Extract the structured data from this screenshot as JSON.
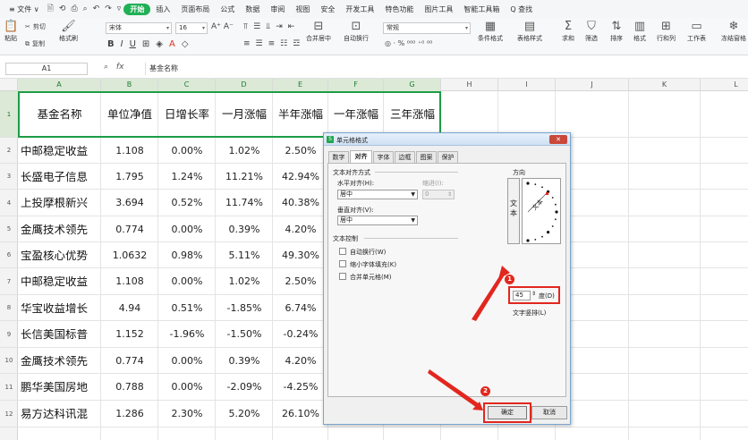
{
  "menu": {
    "items": [
      "≡ 文件 ∨",
      "开始",
      "插入",
      "页面布局",
      "公式",
      "数据",
      "审阅",
      "视图",
      "安全",
      "开发工具",
      "特色功能",
      "图片工具",
      "智能工具箱"
    ],
    "quick_icons": [
      "🗎",
      "⟲",
      "⎙",
      "⌕",
      "↶",
      "↷",
      "▿"
    ],
    "search": "Q 查找",
    "active": "开始"
  },
  "ribbon": {
    "paste": "粘贴",
    "cut": "剪切",
    "format_brush": "格式刷",
    "copy": "复制",
    "font_name": "宋体",
    "font_size": "16",
    "bold": "B",
    "italic": "I",
    "underline": "U",
    "grow_font": "A⁺",
    "shrink_font": "A⁻",
    "merge_center": "合并居中",
    "auto_wrap": "自动换行",
    "number_format": "常规",
    "percent_row": "◎ · % ⁰⁰⁰ ⁺⁰ ⁰⁰",
    "cond_format": "条件格式",
    "table_style": "表格样式",
    "sum": "求和",
    "filter": "筛选",
    "sort": "排序",
    "format": "格式",
    "rows_cols": "行和列",
    "worksheet": "工作表",
    "freeze": "冻结窗格"
  },
  "formula_bar": {
    "name_box": "A1",
    "content": "基金名称"
  },
  "columns": [
    "A",
    "B",
    "C",
    "D",
    "E",
    "F",
    "G",
    "H",
    "I",
    "J",
    "K",
    "L"
  ],
  "rows": [
    "1",
    "2",
    "3",
    "4",
    "5",
    "6",
    "7",
    "8",
    "9",
    "10",
    "11",
    "12"
  ],
  "table": {
    "headers": [
      "基金名称",
      "单位净值",
      "日增长率",
      "一月涨幅",
      "半年涨幅",
      "一年涨幅",
      "三年涨幅"
    ],
    "data": [
      [
        "中邮稳定收益",
        "1.108",
        "0.00%",
        "1.02%",
        "2.50%"
      ],
      [
        "长盛电子信息",
        "1.795",
        "1.24%",
        "11.21%",
        "42.94%"
      ],
      [
        "上投摩根新兴",
        "3.694",
        "0.52%",
        "11.74%",
        "40.38%"
      ],
      [
        "金鹰技术领先",
        "0.774",
        "0.00%",
        "0.39%",
        "4.20%"
      ],
      [
        "宝盈核心优势",
        "1.0632",
        "0.98%",
        "5.11%",
        "49.30%"
      ],
      [
        "中邮稳定收益",
        "1.108",
        "0.00%",
        "1.02%",
        "2.50%"
      ],
      [
        "华宝收益增长",
        "4.94",
        "0.51%",
        "-1.85%",
        "6.74%"
      ],
      [
        "长信美国标普",
        "1.152",
        "-1.96%",
        "-1.50%",
        "-0.24%"
      ],
      [
        "金鹰技术领先",
        "0.774",
        "0.00%",
        "0.39%",
        "4.20%"
      ],
      [
        "鹏华美国房地",
        "0.788",
        "0.00%",
        "-2.09%",
        "-4.25%"
      ],
      [
        "易方达科讯混",
        "1.286",
        "2.30%",
        "5.20%",
        "26.10%"
      ]
    ]
  },
  "dialog": {
    "title": "单元格格式",
    "close": "✕",
    "tabs": [
      "数字",
      "对齐",
      "字体",
      "边框",
      "图案",
      "保护"
    ],
    "active_tab": "对齐",
    "text_align_group": "文本对齐方式",
    "h_align_label": "水平对齐(H):",
    "h_align_value": "居中",
    "indent_label": "缩进(I):",
    "indent_value": "0",
    "v_align_label": "垂直对齐(V):",
    "v_align_value": "居中",
    "text_control_group": "文本控制",
    "wrap": "自动换行(W)",
    "shrink": "缩小字体填充(K)",
    "merge": "合并单元格(M)",
    "orientation": "方向",
    "vertical_text": "文本",
    "dial_text": "文本",
    "degrees_value": "45",
    "degrees_label": "度(D)",
    "vertical_option": "文字竖排(L)",
    "ok": "确定",
    "cancel": "取消"
  },
  "annotations": {
    "badge1": "1",
    "badge2": "2",
    "accent": "#e2271e"
  },
  "colors": {
    "accent_green": "#20b056",
    "selection_green": "#1d9c46"
  }
}
